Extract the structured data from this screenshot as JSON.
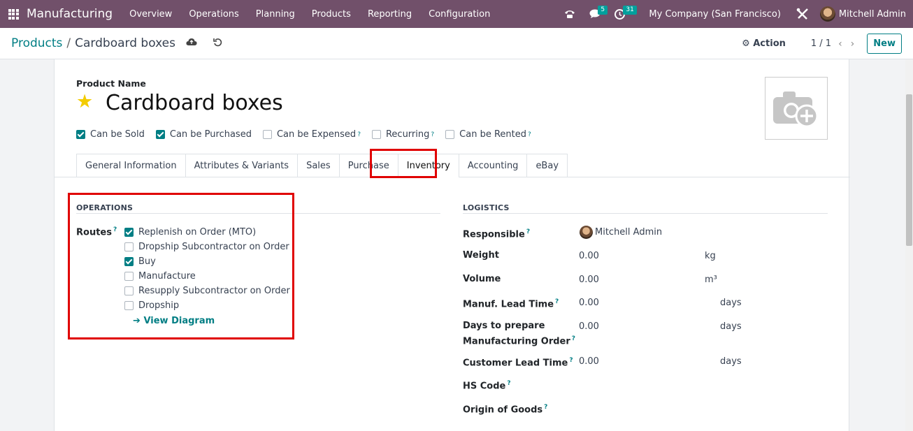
{
  "navbar": {
    "brand": "Manufacturing",
    "menu": [
      "Overview",
      "Operations",
      "Planning",
      "Products",
      "Reporting",
      "Configuration"
    ],
    "messages_count": "5",
    "activities_count": "31",
    "company": "My Company (San Francisco)",
    "user": "Mitchell Admin",
    "bg_color": "#71506a"
  },
  "control_panel": {
    "breadcrumb_parent": "Products",
    "breadcrumb_current": "Cardboard boxes",
    "action_label": "Action",
    "pager": "1 / 1",
    "new_label": "New"
  },
  "product": {
    "name_label": "Product Name",
    "name": "Cardboard boxes",
    "checkboxes": [
      {
        "label": "Can be Sold",
        "checked": true,
        "tip": false
      },
      {
        "label": "Can be Purchased",
        "checked": true,
        "tip": false
      },
      {
        "label": "Can be Expensed",
        "checked": false,
        "tip": true
      },
      {
        "label": "Recurring",
        "checked": false,
        "tip": true
      },
      {
        "label": "Can be Rented",
        "checked": false,
        "tip": true
      }
    ]
  },
  "tabs": [
    "General Information",
    "Attributes & Variants",
    "Sales",
    "Purchase",
    "Inventory",
    "Accounting",
    "eBay"
  ],
  "active_tab": "Inventory",
  "operations": {
    "title": "OPERATIONS",
    "routes_label": "Routes",
    "routes": [
      {
        "label": "Replenish on Order (MTO)",
        "checked": true
      },
      {
        "label": "Dropship Subcontractor on Order",
        "checked": false
      },
      {
        "label": "Buy",
        "checked": true
      },
      {
        "label": "Manufacture",
        "checked": false
      },
      {
        "label": "Resupply Subcontractor on Order",
        "checked": false
      },
      {
        "label": "Dropship",
        "checked": false
      }
    ],
    "view_diagram": "View Diagram"
  },
  "logistics": {
    "title": "LOGISTICS",
    "responsible_label": "Responsible",
    "responsible_value": "Mitchell Admin",
    "weight_label": "Weight",
    "weight_value": "0.00",
    "weight_unit": "kg",
    "volume_label": "Volume",
    "volume_value": "0.00",
    "volume_unit": "m³",
    "manuf_lead_label": "Manuf. Lead Time",
    "manuf_lead_value": "0.00",
    "manuf_lead_unit": "days",
    "days_prepare_label_1": "Days to prepare",
    "days_prepare_label_2": "Manufacturing Order",
    "days_prepare_value": "0.00",
    "days_prepare_unit": "days",
    "customer_lead_label": "Customer Lead Time",
    "customer_lead_value": "0.00",
    "customer_lead_unit": "days",
    "hs_code_label": "HS Code",
    "origin_label": "Origin of Goods"
  },
  "colors": {
    "accent": "#017e84",
    "highlight": "#e00000",
    "star": "#f3cc00"
  }
}
